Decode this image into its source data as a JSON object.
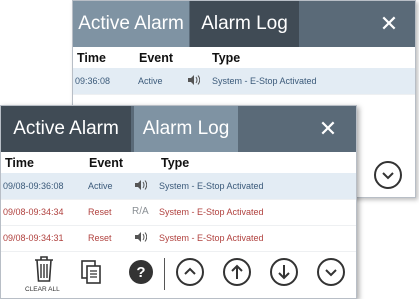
{
  "back_window": {
    "tabs": [
      "Active Alarm",
      "Alarm Log"
    ],
    "close_glyph": "✕",
    "columns": [
      "Time",
      "Event",
      "Type"
    ],
    "rows": [
      {
        "time": "09:36:08",
        "event": "Active",
        "type": "System - E-Stop Activated",
        "icon": "speaker-icon"
      }
    ]
  },
  "front_window": {
    "tabs": [
      "Active Alarm",
      "Alarm Log"
    ],
    "close_glyph": "✕",
    "columns": [
      "Time",
      "Event",
      "Type"
    ],
    "rows": [
      {
        "time": "09/08-09:36:08",
        "event": "Active",
        "ack": "",
        "type": "System - E-Stop Activated",
        "icon": "speaker-icon"
      },
      {
        "time": "09/08-09:34:34",
        "event": "Reset",
        "ack": "R/A",
        "type": "System - E-Stop Activated",
        "icon": "speaker-icon"
      },
      {
        "time": "09/08-09:34:31",
        "event": "Reset",
        "ack": "",
        "type": "System - E-Stop Activated",
        "icon": "speaker-icon"
      }
    ],
    "toolbar": {
      "clear_all_label": "CLEAR ALL",
      "help_glyph": "?"
    }
  },
  "colors": {
    "titlebar_dark": "#404b55",
    "titlebar_light": "#7f93a3",
    "active_text": "#3b5a7a",
    "reset_text": "#b0413e",
    "selected_row": "#e3ecf4"
  }
}
